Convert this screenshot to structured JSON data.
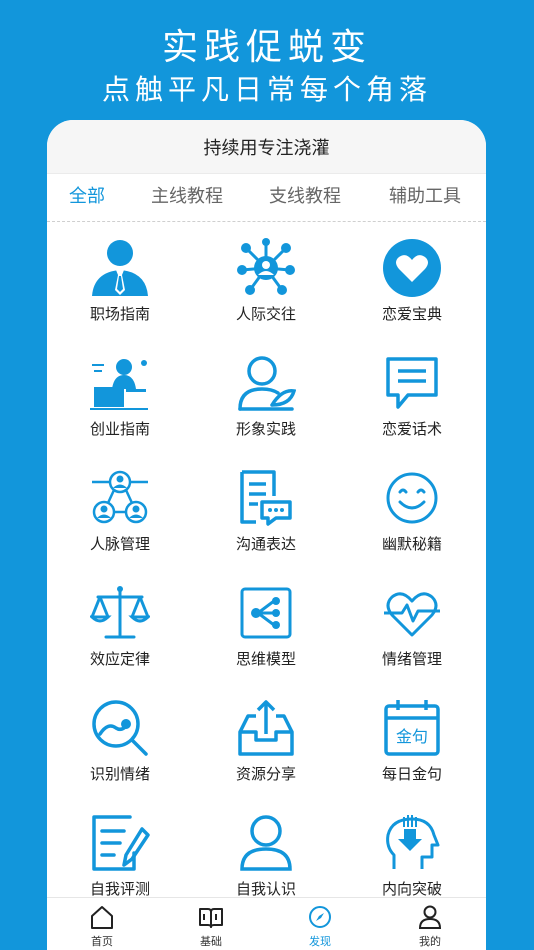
{
  "hero": {
    "title": "实践促蜕变",
    "subtitle": "点触平凡日常每个角落"
  },
  "card": {
    "heading": "持续用专注浇灌"
  },
  "tabs": [
    {
      "label": "全部",
      "active": true
    },
    {
      "label": "主线教程",
      "active": false
    },
    {
      "label": "支线教程",
      "active": false
    },
    {
      "label": "辅助工具",
      "active": false
    }
  ],
  "grid": {
    "items": [
      {
        "label": "职场指南",
        "icon": "businessman-icon"
      },
      {
        "label": "人际交往",
        "icon": "social-network-icon"
      },
      {
        "label": "恋爱宝典",
        "icon": "heart-icon"
      },
      {
        "label": "创业指南",
        "icon": "entrepreneur-desk-icon"
      },
      {
        "label": "形象实践",
        "icon": "person-feather-icon"
      },
      {
        "label": "恋爱话术",
        "icon": "speech-bubble-icon"
      },
      {
        "label": "人脉管理",
        "icon": "contacts-network-icon"
      },
      {
        "label": "沟通表达",
        "icon": "document-chat-icon"
      },
      {
        "label": "幽默秘籍",
        "icon": "smiley-icon"
      },
      {
        "label": "效应定律",
        "icon": "balance-scale-icon"
      },
      {
        "label": "思维模型",
        "icon": "mind-map-icon"
      },
      {
        "label": "情绪管理",
        "icon": "heartbeat-icon"
      },
      {
        "label": "识别情绪",
        "icon": "magnifier-chart-icon"
      },
      {
        "label": "资源分享",
        "icon": "inbox-upload-icon"
      },
      {
        "label": "每日金句",
        "icon": "calendar-quote-icon"
      },
      {
        "label": "自我评测",
        "icon": "edit-note-icon"
      },
      {
        "label": "自我认识",
        "icon": "user-icon"
      },
      {
        "label": "内向突破",
        "icon": "head-download-icon"
      }
    ],
    "calendar_text": "金句"
  },
  "tabbar": [
    {
      "label": "首页",
      "icon": "home-icon",
      "active": false
    },
    {
      "label": "基础",
      "icon": "book-icon",
      "active": false
    },
    {
      "label": "发现",
      "icon": "compass-icon",
      "active": true
    },
    {
      "label": "我的",
      "icon": "person-icon",
      "active": false
    }
  ],
  "colors": {
    "brand": "#1296db",
    "background": "#1296db",
    "card": "#ffffff"
  }
}
